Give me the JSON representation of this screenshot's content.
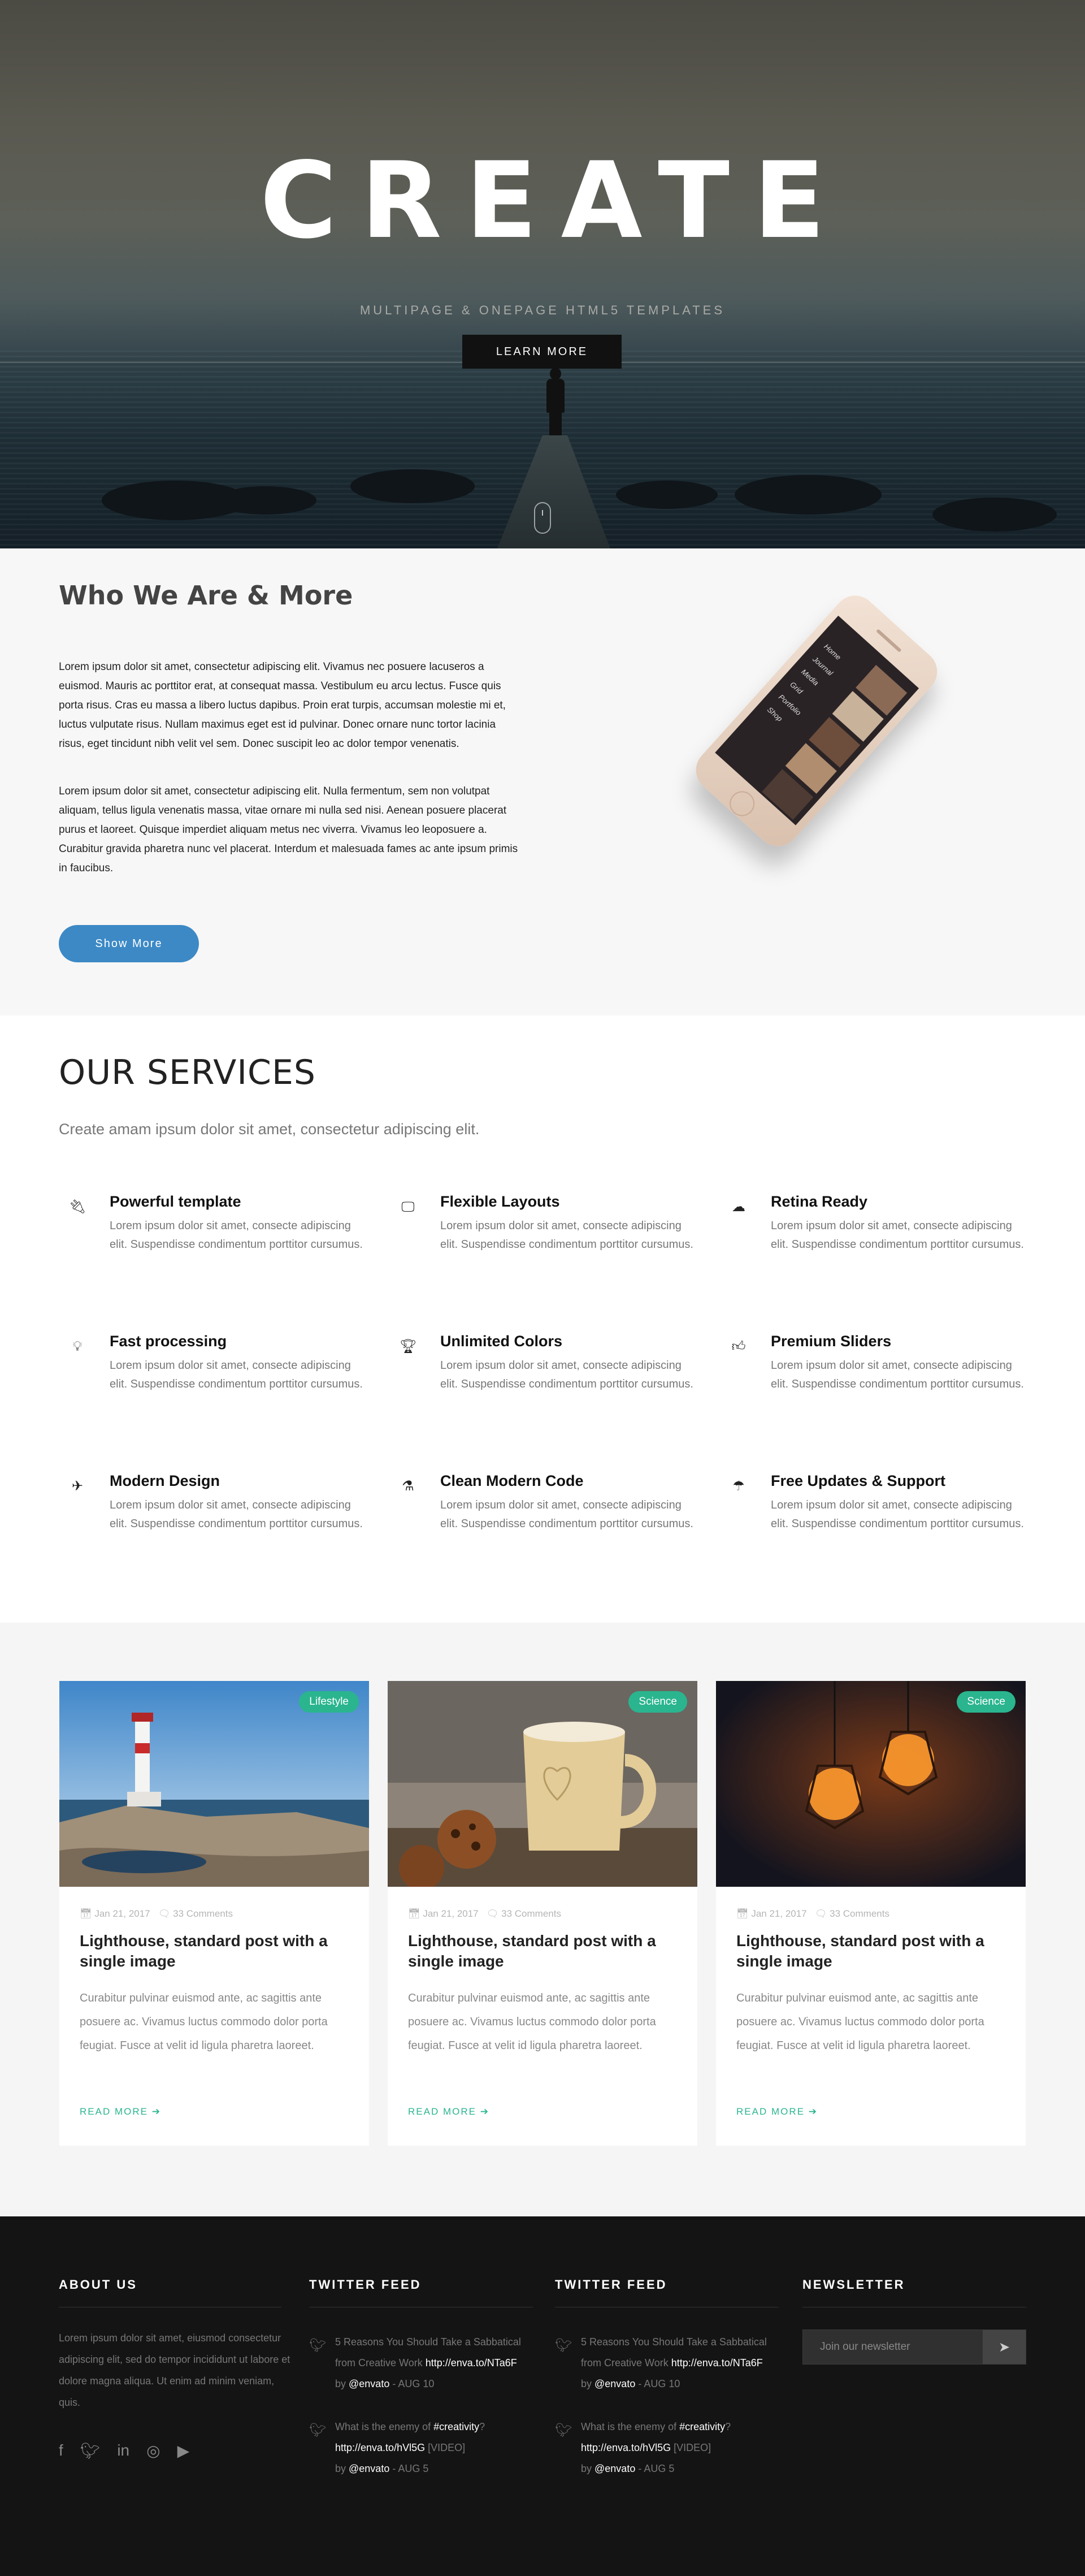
{
  "hero": {
    "title": "CREATE",
    "subtitle": "MULTIPAGE & ONEPAGE HTML5 TEMPLATES",
    "button_label": "LEARN MORE"
  },
  "about": {
    "heading": "Who We Are & More",
    "paragraph1": "Lorem ipsum dolor sit amet, consectetur adipiscing elit. Vivamus nec posuere lacuseros a euismod. Mauris ac porttitor erat, at consequat massa. Vestibulum eu arcu lectus. Fusce quis porta risus. Cras eu massa a libero luctus dapibus. Proin erat turpis, accumsan molestie mi et, luctus vulputate risus. Nullam maximus eget est id pulvinar. Donec ornare nunc tortor lacinia risus, eget tincidunt nibh velit vel sem. Donec suscipit leo ac dolor tempor venenatis.",
    "paragraph2": "Lorem ipsum dolor sit amet, consectetur adipiscing elit. Nulla fermentum, sem non volutpat aliquam, tellus ligula venenatis massa, vitae ornare mi nulla sed nisi. Aenean posuere placerat purus et laoreet. Quisque imperdiet aliquam metus nec viverra. Vivamus leo leoposuere a. Curabitur gravida pharetra nunc vel placerat. Interdum et malesuada fames ac ante ipsum primis in faucibus.",
    "button_label": "Show More",
    "phone_menu": [
      "Home",
      "Journal",
      "Media",
      "Grid",
      "Portfolio",
      "Shop"
    ]
  },
  "services": {
    "heading": "OUR SERVICES",
    "lead": "Create amam ipsum dolor sit amet, consectetur adipiscing elit.",
    "items": [
      {
        "icon": "plug-icon",
        "title": "Powerful template",
        "text": "Lorem ipsum dolor sit amet, consecte adipiscing elit. Suspendisse condimentum porttitor cursumus."
      },
      {
        "icon": "monitor-icon",
        "title": "Flexible Layouts",
        "text": "Lorem ipsum dolor sit amet, consecte adipiscing elit. Suspendisse condimentum porttitor cursumus."
      },
      {
        "icon": "cloud-icon",
        "title": "Retina Ready",
        "text": "Lorem ipsum dolor sit amet, consecte adipiscing elit. Suspendisse condimentum porttitor cursumus."
      },
      {
        "icon": "lightbulb-icon",
        "title": "Fast processing",
        "text": "Lorem ipsum dolor sit amet, consecte adipiscing elit. Suspendisse condimentum porttitor cursumus."
      },
      {
        "icon": "trophy-icon",
        "title": "Unlimited Colors",
        "text": "Lorem ipsum dolor sit amet, consecte adipiscing elit. Suspendisse condimentum porttitor cursumus."
      },
      {
        "icon": "thumbs-up-icon",
        "title": "Premium Sliders",
        "text": "Lorem ipsum dolor sit amet, consecte adipiscing elit. Suspendisse condimentum porttitor cursumus."
      },
      {
        "icon": "rocket-icon",
        "title": "Modern Design",
        "text": "Lorem ipsum dolor sit amet, consecte adipiscing elit. Suspendisse condimentum porttitor cursumus."
      },
      {
        "icon": "flask-icon",
        "title": "Clean Modern Code",
        "text": "Lorem ipsum dolor sit amet, consecte adipiscing elit. Suspendisse condimentum porttitor cursumus."
      },
      {
        "icon": "umbrella-icon",
        "title": "Free Updates & Support",
        "text": "Lorem ipsum dolor sit amet, consecte adipiscing elit. Suspendisse condimentum porttitor cursumus."
      }
    ]
  },
  "blog": {
    "posts": [
      {
        "badge": "Lifestyle",
        "date": "Jan 21, 2017",
        "comments": "33 Comments",
        "title": "Lighthouse, standard post with a single image",
        "excerpt": "Curabitur pulvinar euismod ante, ac sagittis ante posuere ac. Vivamus luctus commodo dolor porta feugiat. Fusce at velit id ligula pharetra laoreet.",
        "read_more": "READ MORE"
      },
      {
        "badge": "Science",
        "date": "Jan 21, 2017",
        "comments": "33 Comments",
        "title": "Lighthouse, standard post with a single image",
        "excerpt": "Curabitur pulvinar euismod ante, ac sagittis ante posuere ac. Vivamus luctus commodo dolor porta feugiat. Fusce at velit id ligula pharetra laoreet.",
        "read_more": "READ MORE"
      },
      {
        "badge": "Science",
        "date": "Jan 21, 2017",
        "comments": "33 Comments",
        "title": "Lighthouse, standard post with a single image",
        "excerpt": "Curabitur pulvinar euismod ante, ac sagittis ante posuere ac. Vivamus luctus commodo dolor porta feugiat. Fusce at velit id ligula pharetra laoreet.",
        "read_more": "READ MORE"
      }
    ],
    "accent": "#2ab58f"
  },
  "footer": {
    "about_heading": "ABOUT US",
    "about_text": "Lorem ipsum dolor sit amet, eiusmod consectetur adipiscing elit, sed do tempor incididunt ut labore et dolore magna aliqua. Ut enim ad minim veniam, quis.",
    "social": [
      "facebook-icon",
      "twitter-icon",
      "linkedin-icon",
      "dribbble-icon",
      "youtube-icon"
    ],
    "twitter_heading": "TWITTER FEED",
    "tweets": [
      {
        "pre": "5 Reasons You Should Take a Sabbatical from Creative Work ",
        "link": "http://enva.to/NTa6F",
        "by": "by ",
        "user": "@envato",
        "when": " - AUG 10"
      },
      {
        "pre": "What is the enemy of ",
        "tag": "#creativity",
        "q": "?",
        "link": "http://enva.to/hVl5G",
        "video": " [VIDEO]",
        "by": "by ",
        "user": "@envato",
        "when": " - AUG 5"
      }
    ],
    "newsletter_heading": "NEWSLETTER",
    "newsletter_placeholder": "Join our newsletter"
  }
}
